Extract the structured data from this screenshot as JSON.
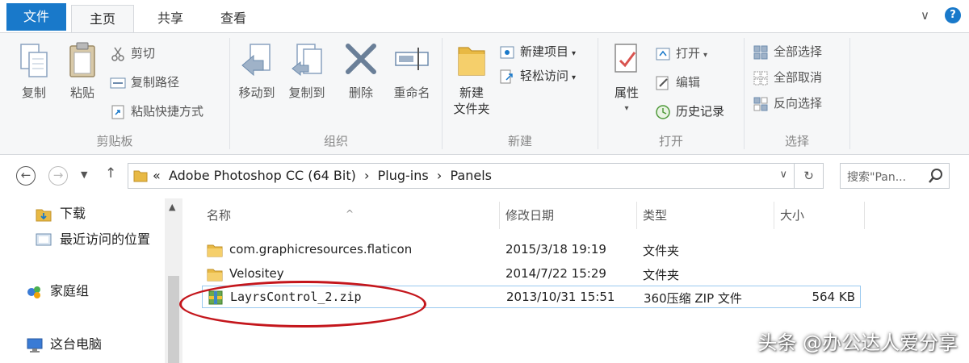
{
  "tabs": {
    "file": "文件",
    "home": "主页",
    "share": "共享",
    "view": "查看"
  },
  "window": {
    "expand_glyph": "∨",
    "help_glyph": "?"
  },
  "ribbon": {
    "clipboard": {
      "title": "剪贴板",
      "copy": "复制",
      "paste": "粘贴",
      "cut": "剪切",
      "copy_path": "复制路径",
      "paste_shortcut": "粘贴快捷方式"
    },
    "organize": {
      "title": "组织",
      "move_to": "移动到",
      "copy_to": "复制到",
      "delete": "删除",
      "rename": "重命名"
    },
    "new": {
      "title": "新建",
      "new_folder_line1": "新建",
      "new_folder_line2": "文件夹",
      "new_item": "新建项目",
      "easy_access": "轻松访问"
    },
    "open": {
      "title": "打开",
      "properties": "属性",
      "open": "打开",
      "edit": "编辑",
      "history": "历史记录"
    },
    "select": {
      "title": "选择",
      "select_all": "全部选择",
      "select_none": "全部取消",
      "invert": "反向选择"
    }
  },
  "address": {
    "path_prefix": "«",
    "path": [
      "Adobe Photoshop CC (64 Bit)",
      "Plug-ins",
      "Panels"
    ],
    "separator": "›",
    "search_placeholder": "搜索\"Pan..."
  },
  "nav_pane": {
    "items": [
      {
        "label": "下载",
        "icon": "download-folder-icon"
      },
      {
        "label": "最近访问的位置",
        "icon": "recent-places-icon"
      },
      {
        "label": "家庭组",
        "icon": "homegroup-icon"
      },
      {
        "label": "这台电脑",
        "icon": "computer-icon"
      }
    ]
  },
  "file_list": {
    "columns": {
      "name": "名称",
      "date": "修改日期",
      "type": "类型",
      "size": "大小"
    },
    "rows": [
      {
        "name": "com.graphicresources.flaticon",
        "date": "2015/3/18 19:19",
        "type": "文件夹",
        "size": "",
        "icon": "folder-icon"
      },
      {
        "name": "Velositey",
        "date": "2014/7/22 15:29",
        "type": "文件夹",
        "size": "",
        "icon": "folder-icon"
      },
      {
        "name": "LayrsControl_2.zip",
        "date": "2013/10/31 15:51",
        "type": "360压缩 ZIP 文件",
        "size": "564 KB",
        "icon": "zip-archive-icon"
      }
    ]
  },
  "watermark": "头条 @办公达人爱分享",
  "colors": {
    "file_tab": "#1979ca",
    "selection_border": "#99c9ef",
    "annotation_red": "#c4161c",
    "folder_yellow": "#e8b944"
  }
}
